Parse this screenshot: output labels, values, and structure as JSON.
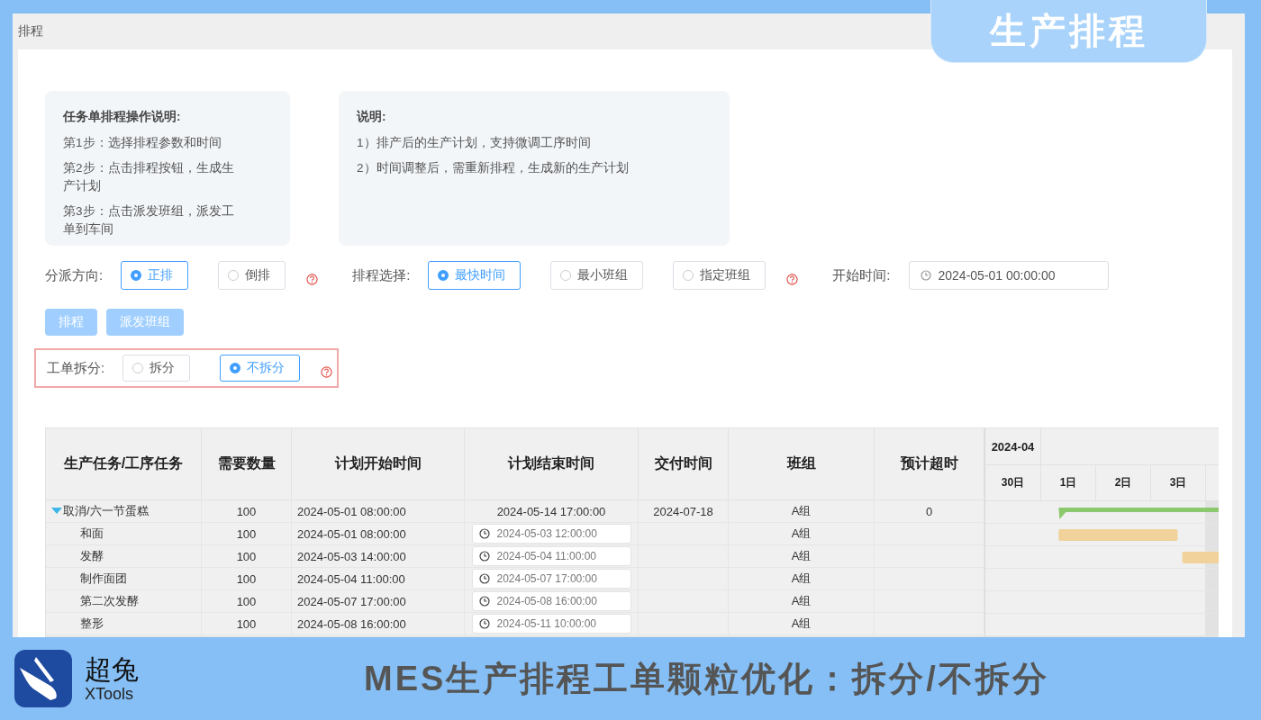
{
  "tab_banner": {
    "title": "生产排程"
  },
  "page": {
    "title": "排程"
  },
  "notes": [
    {
      "title": "任务单排程操作说明:",
      "lines": [
        "第1步：选择排程参数和时间",
        "第2步：点击排程按钮，生成生产计划",
        "第3步：点击派发班组，派发工单到车间"
      ]
    },
    {
      "title": "说明:",
      "lines": [
        "1）排产后的生产计划，支持微调工序时间",
        "2）时间调整后，需重新排程，生成新的生产计划"
      ]
    }
  ],
  "form": {
    "groups": [
      {
        "label": "分派方向:",
        "options": [
          {
            "label": "正排",
            "selected": true
          },
          {
            "label": "倒排",
            "selected": false
          }
        ]
      },
      {
        "label": "排程选择:",
        "options": [
          {
            "label": "最快时间",
            "selected": true
          },
          {
            "label": "最小班组",
            "selected": false
          },
          {
            "label": "指定班组",
            "selected": false
          }
        ]
      }
    ],
    "start_time": {
      "label": "开始时间:",
      "value": "2024-05-01 00:00:00"
    }
  },
  "buttons": [
    "排程",
    "派发班组"
  ],
  "split": {
    "label": "工单拆分:",
    "highlighted": true,
    "options": [
      {
        "label": "拆分",
        "selected": false
      },
      {
        "label": "不拆分",
        "selected": true
      }
    ]
  },
  "table": {
    "columns": [
      "生产任务/工序任务",
      "需要数量",
      "计划开始时间",
      "计划结束时间",
      "交付时间",
      "班组",
      "预计超时"
    ],
    "gantt": {
      "month": "2024-04",
      "days": [
        "30日",
        "1日",
        "2日",
        "3日"
      ]
    },
    "rows": [
      {
        "task": "取消/六一节蛋糕",
        "expanded": true,
        "qty": "100",
        "start": "2024-05-01 08:00:00",
        "end": "2024-05-14 17:00:00",
        "delivery": "2024-07-18",
        "team": "A组",
        "overtime": "0",
        "children": [
          {
            "task": "和面",
            "qty": "100",
            "start": "2024-05-01 08:00:00",
            "end": "2024-05-03 12:00:00",
            "team": "A组"
          },
          {
            "task": "发酵",
            "qty": "100",
            "start": "2024-05-03 14:00:00",
            "end": "2024-05-04 11:00:00",
            "team": "A组"
          },
          {
            "task": "制作面团",
            "qty": "100",
            "start": "2024-05-04 11:00:00",
            "end": "2024-05-07 17:00:00",
            "team": "A组"
          },
          {
            "task": "第二次发酵",
            "qty": "100",
            "start": "2024-05-07 17:00:00",
            "end": "2024-05-08 16:00:00",
            "team": "A组"
          },
          {
            "task": "整形",
            "qty": "100",
            "start": "2024-05-08 16:00:00",
            "end": "2024-05-11 10:00:00",
            "team": "A组"
          }
        ]
      }
    ]
  },
  "footer": {
    "brand": "超兔",
    "brand_sub": "XTools",
    "title": "MES生产排程工单颗粒优化：拆分/不拆分"
  }
}
